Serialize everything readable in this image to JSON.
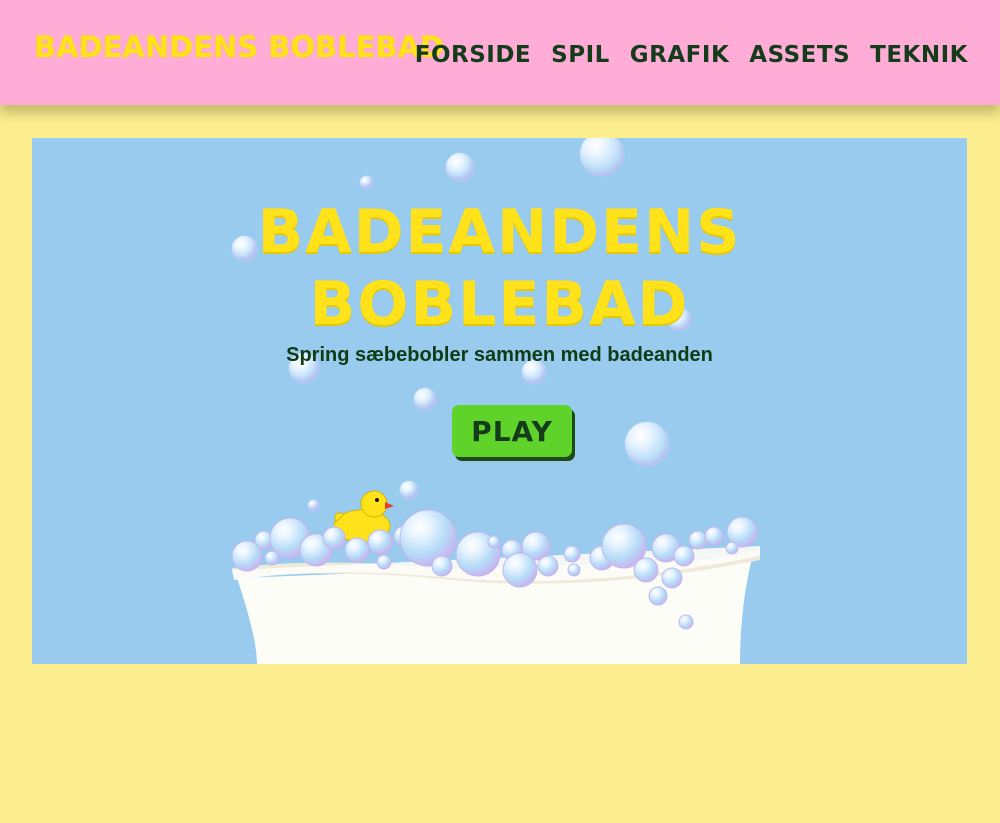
{
  "header": {
    "brand": "BADEANDENS BOBLEBAD",
    "nav": [
      "FORSIDE",
      "SPIL",
      "GRAFIK",
      "ASSETS",
      "TEKNIK"
    ]
  },
  "hero": {
    "title_line1": "BADEANDENS",
    "title_line2": "BOBLEBAD",
    "subtitle": "Spring sæbebobler sammen med badeanden",
    "play_label": "PLAY"
  },
  "colors": {
    "page_bg": "#fdee8f",
    "header_bg": "#ffadd6",
    "stage_bg": "#98cbee",
    "title_yellow": "#ffe21a",
    "dark_green": "#143c1a",
    "play_green": "#5fd32a"
  }
}
